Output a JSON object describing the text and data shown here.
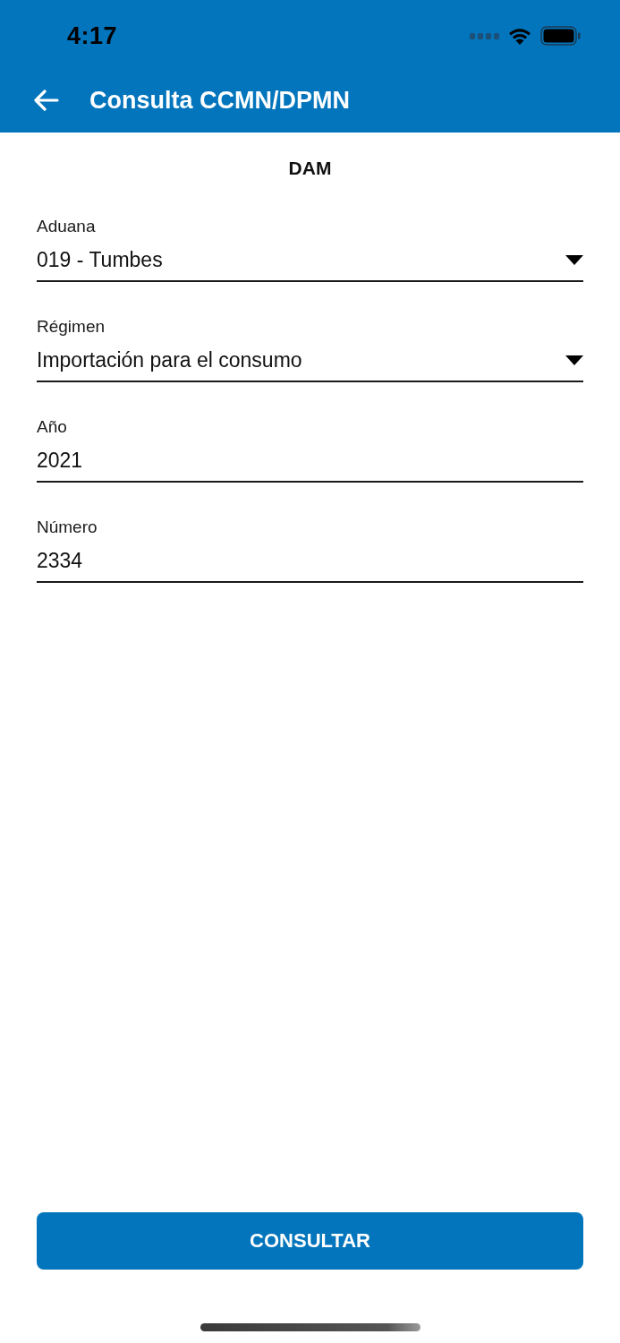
{
  "status_bar": {
    "time": "4:17"
  },
  "nav_bar": {
    "title": "Consulta CCMN/DPMN"
  },
  "section_title": "DAM",
  "fields": [
    {
      "kind": "select",
      "label": "Aduana",
      "value": "019 - Tumbes"
    },
    {
      "kind": "select",
      "label": "Régimen",
      "value": "Importación para el consumo"
    },
    {
      "kind": "text",
      "label": "Año",
      "value": "2021"
    },
    {
      "kind": "text",
      "label": "Número",
      "value": "2334"
    }
  ],
  "primary_button": {
    "label": "CONSULTAR"
  }
}
